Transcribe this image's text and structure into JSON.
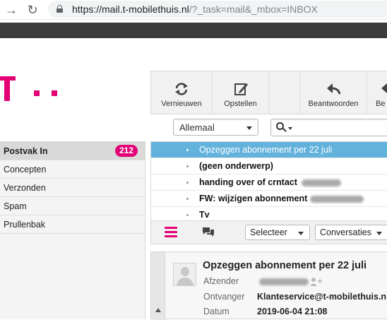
{
  "browser": {
    "url_host": "https://mail.t-mobilethuis.nl",
    "url_path": "/?_task=mail&_mbox=INBOX"
  },
  "colors": {
    "brand": "#e20074",
    "selected_row": "#62b2dc",
    "chrome_band": "#3b3b3b"
  },
  "toolbar": {
    "buttons": [
      {
        "label": "Vernieuwen",
        "icon": "refresh-icon"
      },
      {
        "label": "Opstellen",
        "icon": "compose-icon"
      },
      {
        "label": "Beantwoorden",
        "icon": "reply-icon"
      },
      {
        "label": "Be",
        "icon": "reply-all-icon"
      }
    ]
  },
  "filter": {
    "selected": "Allemaal"
  },
  "search": {
    "icon": "search-icon"
  },
  "folders": [
    {
      "label": "Postvak In",
      "count": "212",
      "active": true
    },
    {
      "label": "Concepten"
    },
    {
      "label": "Verzonden"
    },
    {
      "label": "Spam"
    },
    {
      "label": "Prullenbak"
    }
  ],
  "messages": [
    {
      "subject": "Opzeggen abonnement per 22 juli",
      "selected": true
    },
    {
      "subject": "(geen onderwerp)"
    },
    {
      "subject": "handing over of crntact"
    },
    {
      "subject": "FW: wijzigen abonnement"
    },
    {
      "subject": "Tv"
    }
  ],
  "list_footer": {
    "select_label": "Selecteer",
    "threads_label": "Conversaties"
  },
  "preview": {
    "subject": "Opzeggen abonnement per 22 juli",
    "from_label": "Afzender",
    "to_label": "Ontvanger",
    "to_value": "Klanteservice@t-mobilethuis.nl",
    "date_label": "Datum",
    "date_value": "2019-06-04 21:08"
  }
}
